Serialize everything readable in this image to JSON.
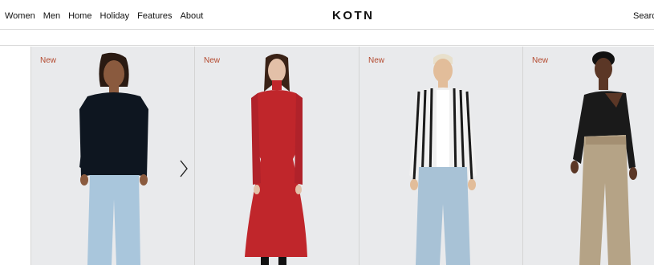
{
  "header": {
    "nav": [
      "Women",
      "Men",
      "Home",
      "Holiday",
      "Features",
      "About"
    ],
    "logo": "KOTN",
    "search_label": "Search"
  },
  "products": [
    {
      "badge": "New",
      "top_color": "#0e1620",
      "pants_color": "#a9c6dc",
      "skin": "#8a5a3e",
      "hair": "#2a1a12"
    },
    {
      "badge": "New",
      "top_color": "#c0262b",
      "pants_color": "#c0262b",
      "skin": "#e3c0a8",
      "hair": "#3a2216"
    },
    {
      "badge": "New",
      "top_color": "#f0f0f0",
      "pants_color": "#a8c2d6",
      "skin": "#e2bd9a",
      "hair": "#e8e0cc"
    },
    {
      "badge": "New",
      "top_color": "#1a1a1a",
      "pants_color": "#b5a386",
      "skin": "#5b3726",
      "hair": "#111111"
    }
  ],
  "carousel": {
    "next_icon": "chevron-right-icon"
  }
}
